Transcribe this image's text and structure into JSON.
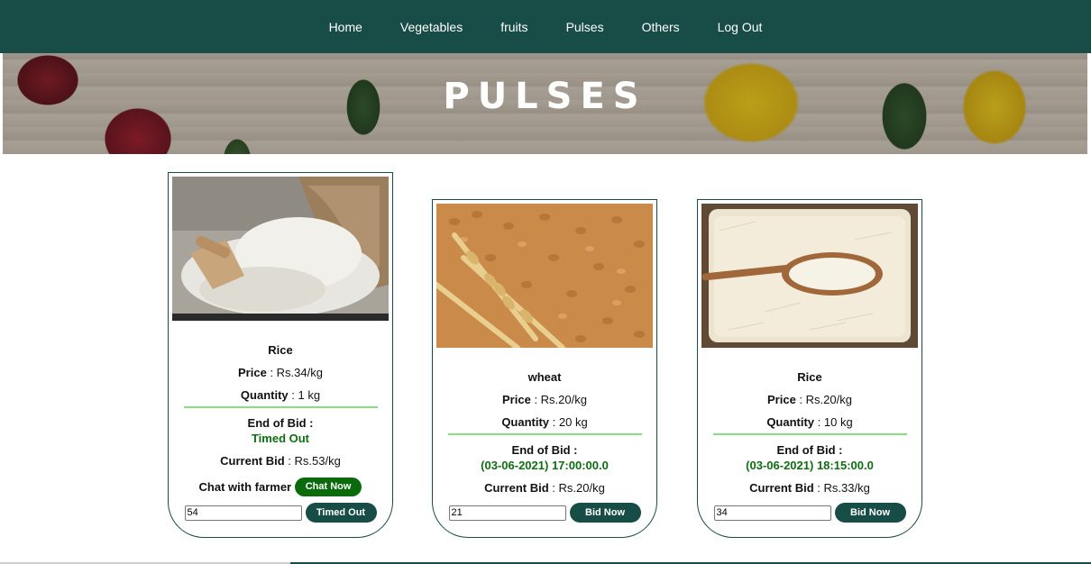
{
  "nav": {
    "items": [
      {
        "label": "Home"
      },
      {
        "label": "Vegetables"
      },
      {
        "label": "fruits"
      },
      {
        "label": "Pulses"
      },
      {
        "label": "Others"
      },
      {
        "label": "Log Out"
      }
    ]
  },
  "banner": {
    "title": "PULSES"
  },
  "labels": {
    "price": "Price",
    "quantity": "Quantity",
    "end_of_bid": "End of Bid :",
    "current_bid": "Current Bid",
    "chat_with_farmer": "Chat with farmer",
    "chat_now": "Chat Now"
  },
  "products": [
    {
      "name": "Rice",
      "price": " : Rs.34/kg",
      "quantity": " : 1 kg",
      "end_of_bid": "Timed Out",
      "current_bid": " : Rs.53/kg",
      "bid_input": "54",
      "button": "Timed Out"
    },
    {
      "name": "wheat",
      "price": " : Rs.20/kg",
      "quantity": " : 20 kg",
      "end_of_bid": "(03-06-2021) 17:00:00.0",
      "current_bid": " : Rs.20/kg",
      "bid_input": "21",
      "button": "Bid Now"
    },
    {
      "name": "Rice",
      "price": " : Rs.20/kg",
      "quantity": " : 10 kg",
      "end_of_bid": "(03-06-2021) 18:15:00.0",
      "current_bid": " : Rs.33/kg",
      "bid_input": "34",
      "button": "Bid Now"
    }
  ]
}
